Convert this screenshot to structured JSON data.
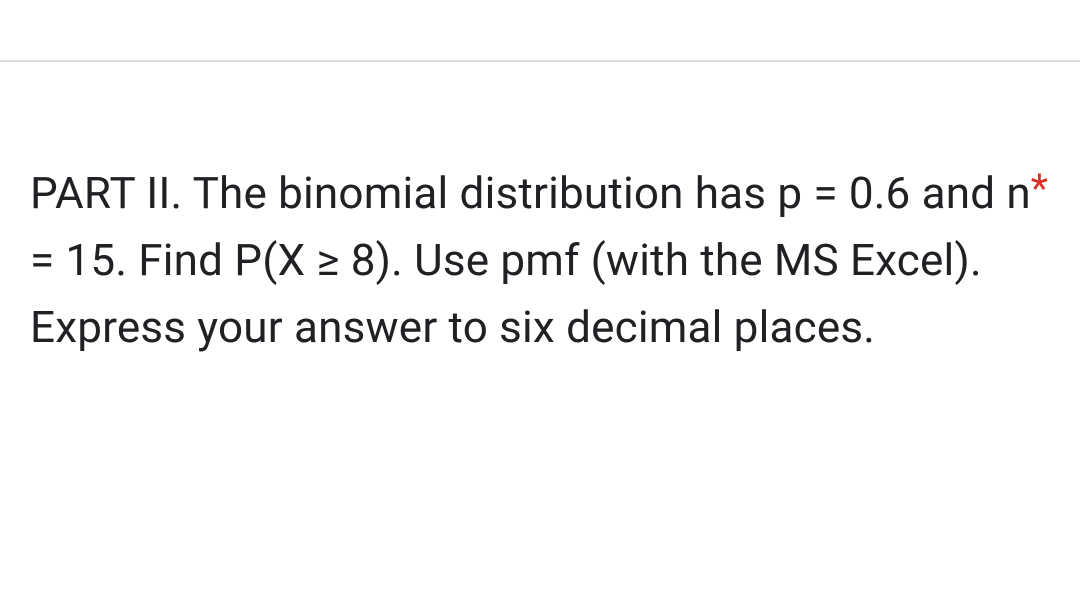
{
  "question": {
    "text": "PART II.  The binomial distribution has p = 0.6   and n = 15.  Find P(X ≥ 8).  Use pmf (with the MS Excel).  Express your answer to six decimal places.",
    "required_marker": "*"
  }
}
